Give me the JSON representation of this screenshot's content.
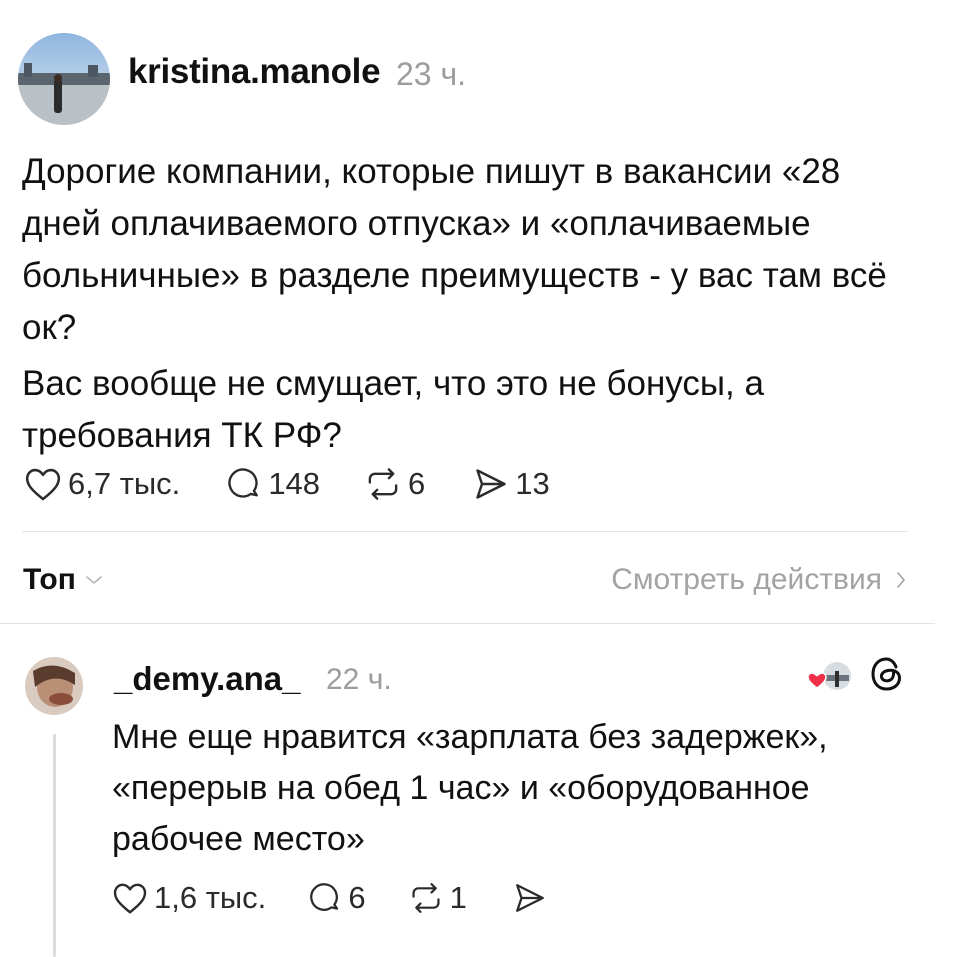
{
  "post": {
    "username": "kristina.manole",
    "time": "23 ч.",
    "paragraphs": [
      "Дорогие компании, которые пишут в вакансии «28 дней оплачиваемого отпуска» и «оплачиваемые больничные» в разделе преимуществ - у вас там всё ок?",
      "Вас вообще не смущает, что это не бонусы, а требования ТК РФ?"
    ],
    "likes": "6,7 тыс.",
    "replies": "148",
    "reposts": "6",
    "shares": "13"
  },
  "sort": {
    "label": "Топ",
    "view_actions": "Смотреть действия"
  },
  "reply": {
    "username": "_demy.ana_",
    "time": "22 ч.",
    "text": "Мне еще нравится «зарплата без задержек», «перерыв на обед 1 час» и «оборудованное рабочее место»",
    "likes": "1,6 тыс.",
    "replies": "6",
    "reposts": "1",
    "shares": ""
  },
  "colors": {
    "text": "#111111",
    "muted": "#9c9c9c",
    "divider": "#e3e3e3",
    "like_red": "#f0304a"
  },
  "icons": [
    "heart-icon",
    "comment-icon",
    "repost-icon",
    "share-icon",
    "chevron-down-icon",
    "chevron-right-icon",
    "threads-logo-icon"
  ]
}
